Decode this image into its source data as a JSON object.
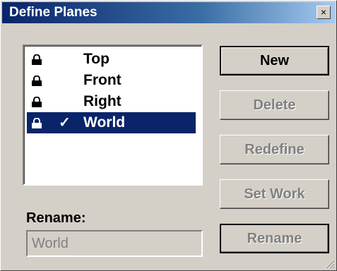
{
  "window": {
    "title": "Define Planes",
    "close_glyph": "×"
  },
  "planes": [
    {
      "name": "Top",
      "locked": true,
      "checked": false,
      "selected": false,
      "icon": "lock-icon"
    },
    {
      "name": "Front",
      "locked": true,
      "checked": false,
      "selected": false,
      "icon": "lock-icon"
    },
    {
      "name": "Right",
      "locked": true,
      "checked": false,
      "selected": false,
      "icon": "lock-icon"
    },
    {
      "name": "World",
      "locked": true,
      "checked": true,
      "selected": true,
      "icon": "lock-icon",
      "check": "✓"
    }
  ],
  "buttons": {
    "new": "New",
    "delete": "Delete",
    "redefine": "Redefine",
    "set_work": "Set Work",
    "rename": "Rename"
  },
  "rename": {
    "label": "Rename:",
    "value": "World"
  },
  "colors": {
    "title_bar": "#0a246a",
    "selection": "#0a246a",
    "face": "#d4d0c8",
    "disabled_text": "#808080"
  }
}
